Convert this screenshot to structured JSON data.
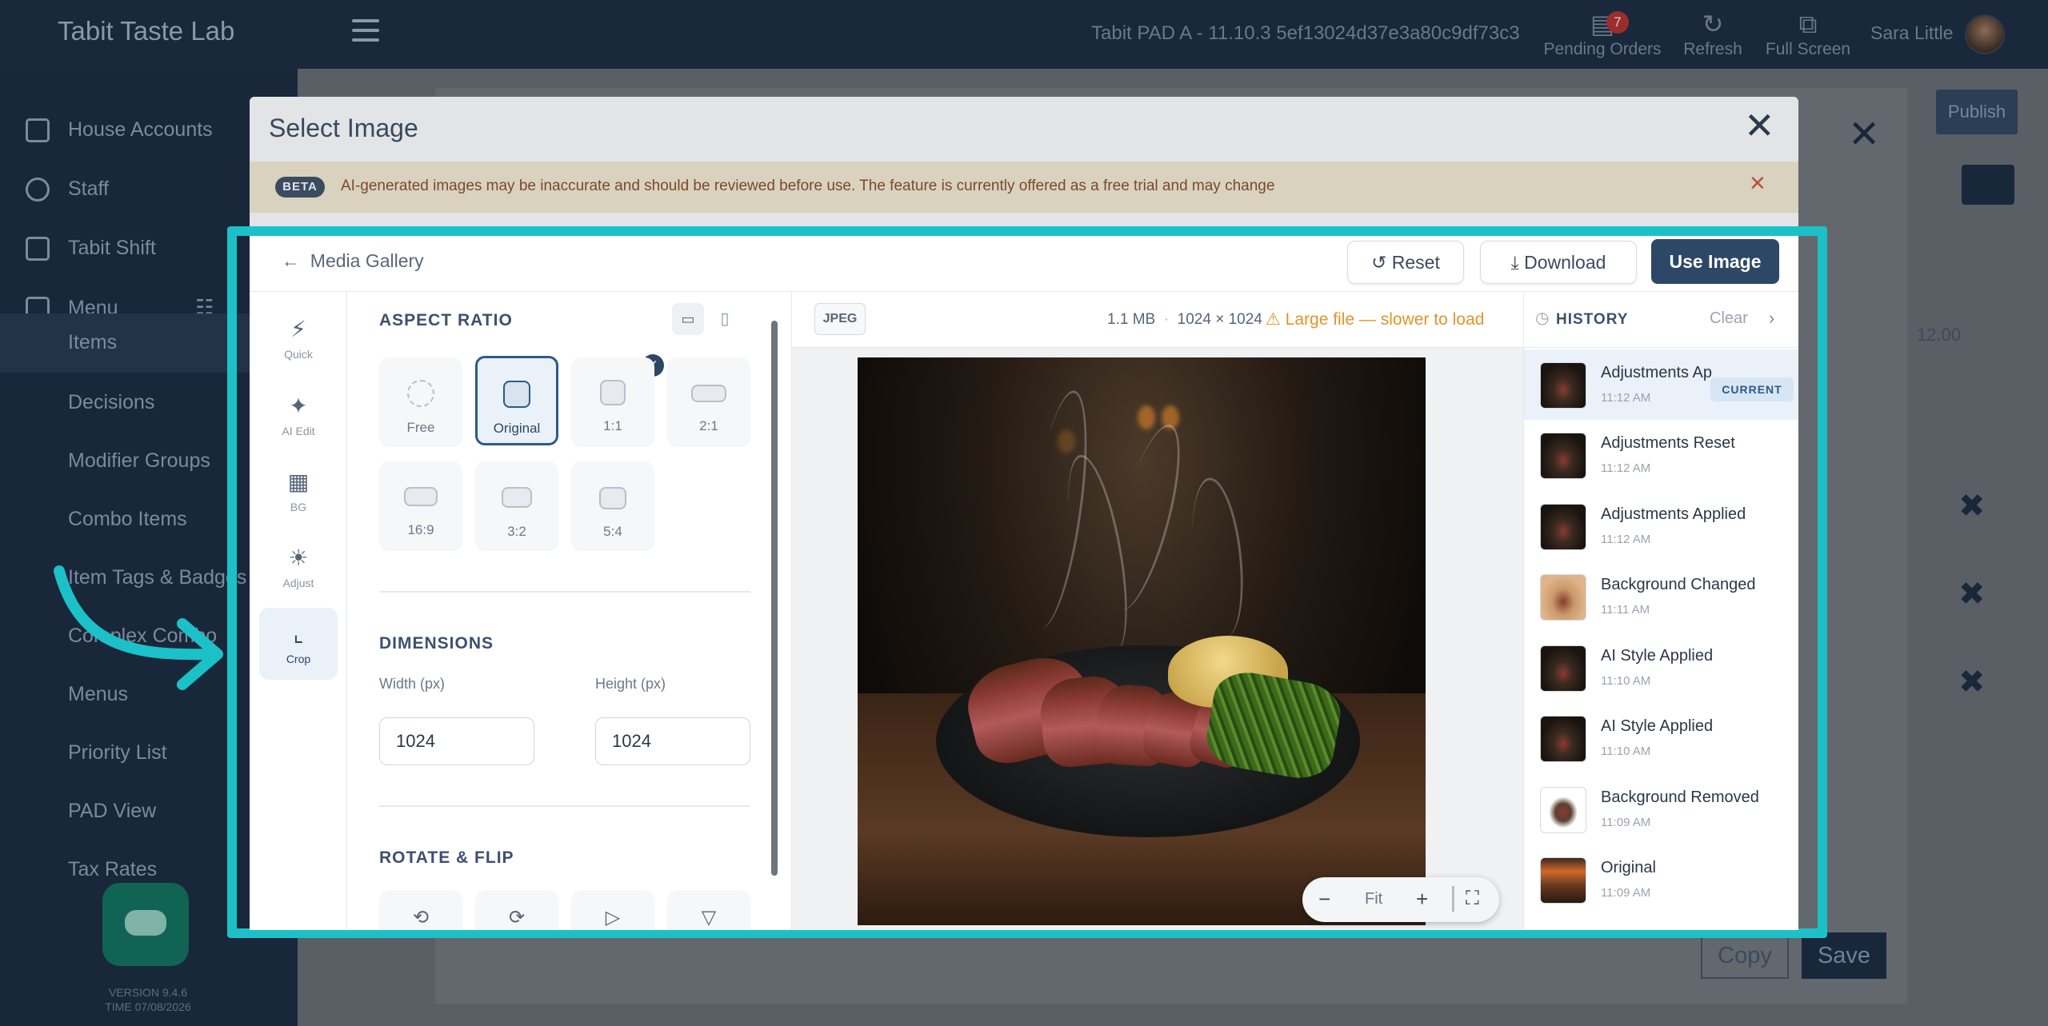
{
  "app": {
    "brand": "Tabit Taste Lab",
    "pad_name": "Tabit PAD A - 11.10.3   5ef13024d37e3a80c9df73c3",
    "pending_orders_label": "Pending Orders",
    "pending_orders_count": "7",
    "refresh_label": "Refresh",
    "fullscreen_label": "Full Screen",
    "user_name": "Sara Little"
  },
  "sidebar": {
    "items": [
      {
        "label": "House Accounts",
        "icon": "house-icon"
      },
      {
        "label": "Staff",
        "icon": "staff-icon"
      },
      {
        "label": "Tabit Shift",
        "icon": "calendar-icon"
      },
      {
        "label": "Menu",
        "icon": "menu-book-icon"
      }
    ],
    "sub_items": [
      {
        "label": "Items"
      },
      {
        "label": "Decisions"
      },
      {
        "label": "Modifier Groups"
      },
      {
        "label": "Combo Items"
      },
      {
        "label": "Item Tags & Badges"
      },
      {
        "label": "Complex Combo"
      },
      {
        "label": "Menus"
      },
      {
        "label": "Priority List"
      },
      {
        "label": "PAD View"
      },
      {
        "label": "Tax Rates"
      }
    ],
    "version": "VERSION 9.4.6",
    "time": "TIME 07/08/2026"
  },
  "background_page": {
    "publish_label": "Publish",
    "price": "12.00",
    "copy_label": "Copy",
    "save_label": "Save"
  },
  "modal": {
    "title": "Select Image",
    "beta_badge": "BETA",
    "beta_notice": "AI-generated images may be inaccurate and should be reviewed before use. The feature is currently offered as a free trial and may change"
  },
  "editor": {
    "back_label": "Media Gallery",
    "reset_label": "Reset",
    "download_label": "Download",
    "use_image_label": "Use Image",
    "tools": [
      {
        "label": "Quick",
        "icon": "lightning-icon"
      },
      {
        "label": "AI Edit",
        "icon": "magic-wand-icon"
      },
      {
        "label": "BG",
        "icon": "image-icon"
      },
      {
        "label": "Adjust",
        "icon": "sun-icon"
      },
      {
        "label": "Crop",
        "icon": "crop-icon",
        "active": true
      }
    ],
    "aspect_ratio": {
      "heading": "ASPECT RATIO",
      "selected": "Original",
      "options": [
        "Free",
        "Original",
        "1:1",
        "2:1",
        "16:9",
        "3:2",
        "5:4"
      ]
    },
    "dimensions": {
      "heading": "DIMENSIONS",
      "width_label": "Width (px)",
      "height_label": "Height (px)",
      "width_value": "1024",
      "height_value": "1024"
    },
    "rotate_flip": {
      "heading": "ROTATE & FLIP"
    },
    "preview": {
      "format": "JPEG",
      "file_size": "1.1 MB",
      "resolution": "1024 × 1024",
      "warning": "Large file — slower to load",
      "zoom_label": "Fit"
    },
    "history": {
      "title": "HISTORY",
      "clear_label": "Clear",
      "current_badge": "CURRENT",
      "entries": [
        {
          "name": "Adjustments Applied",
          "time": "11:12 AM",
          "current": true
        },
        {
          "name": "Adjustments Reset",
          "time": "11:12 AM"
        },
        {
          "name": "Adjustments Applied",
          "time": "11:12 AM"
        },
        {
          "name": "Background Changed",
          "time": "11:11 AM"
        },
        {
          "name": "AI Style Applied",
          "time": "11:10 AM"
        },
        {
          "name": "AI Style Applied",
          "time": "11:10 AM"
        },
        {
          "name": "Background Removed",
          "time": "11:09 AM"
        },
        {
          "name": "Original",
          "time": "11:09 AM"
        }
      ]
    }
  },
  "colors": {
    "highlight_frame": "#1bc1c7",
    "primary": "#2d4766",
    "warning": "#e4932a"
  }
}
